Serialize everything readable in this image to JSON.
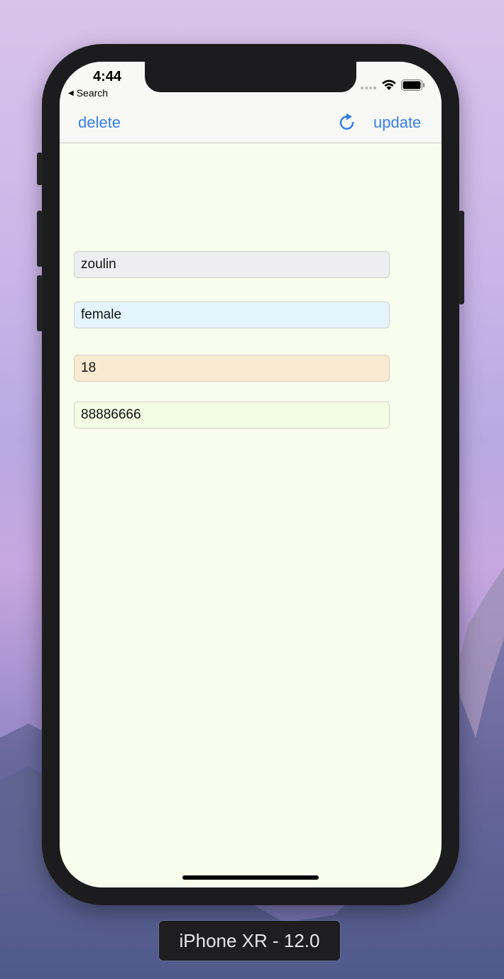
{
  "status_bar": {
    "time": "4:44",
    "back_app_label": "Search",
    "back_arrow": "◀"
  },
  "navbar": {
    "delete_label": "delete",
    "update_label": "update",
    "refresh_icon": "refresh-icon"
  },
  "form": {
    "name_value": "zoulin",
    "gender_value": "female",
    "age_value": "18",
    "phone_value": "88886666"
  },
  "simulator": {
    "device_label": "iPhone XR - 12.0"
  },
  "colors": {
    "accent": "#3880e8",
    "screen_background": "#f9fdee",
    "name_field_bg": "#eeeef2",
    "gender_field_bg": "#e4f4fd",
    "age_field_bg": "#f9ead1",
    "phone_field_bg": "#f3fde4"
  }
}
